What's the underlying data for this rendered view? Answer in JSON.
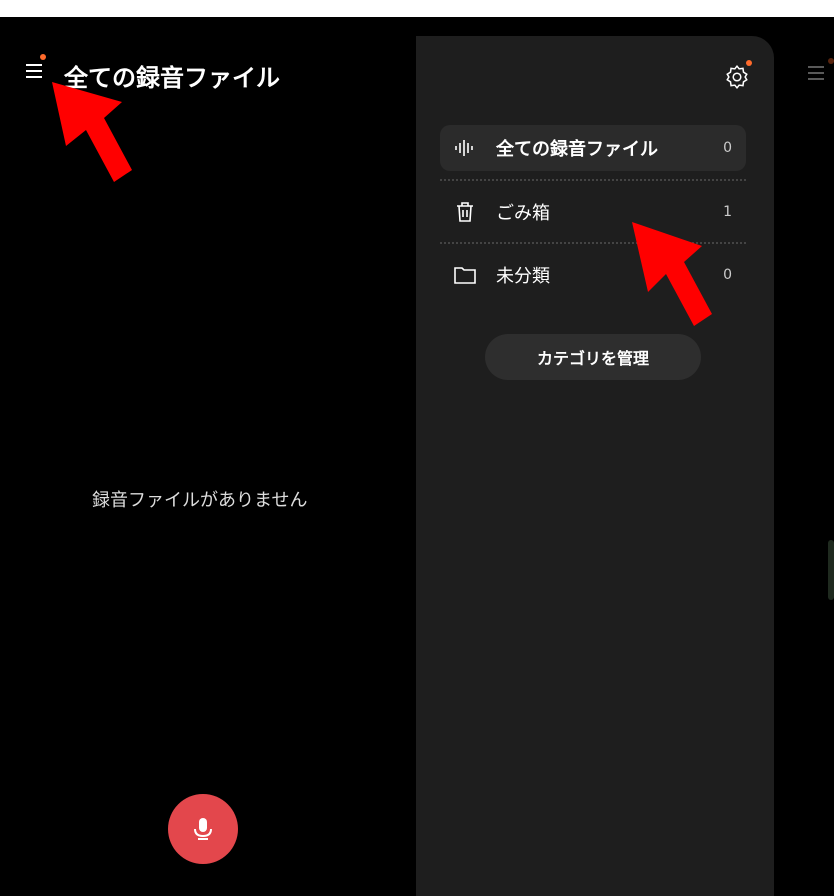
{
  "header": {
    "title": "全ての録音ファイル"
  },
  "main": {
    "empty_message": "録音ファイルがありません"
  },
  "drawer": {
    "categories": [
      {
        "label": "全ての録音ファイル",
        "count": "0"
      },
      {
        "label": "ごみ箱",
        "count": "1"
      },
      {
        "label": "未分類",
        "count": "0"
      }
    ],
    "manage_label": "カテゴリを管理"
  },
  "colors": {
    "accent_dot": "#ff6a2b",
    "record_button": "#e3474c",
    "annotation_arrow": "#ff0000"
  },
  "icons": {
    "menu": "hamburger-icon",
    "settings": "gear-icon",
    "all_files": "waveform-icon",
    "trash": "trash-icon",
    "uncategorized": "folder-icon",
    "record": "microphone-icon"
  }
}
